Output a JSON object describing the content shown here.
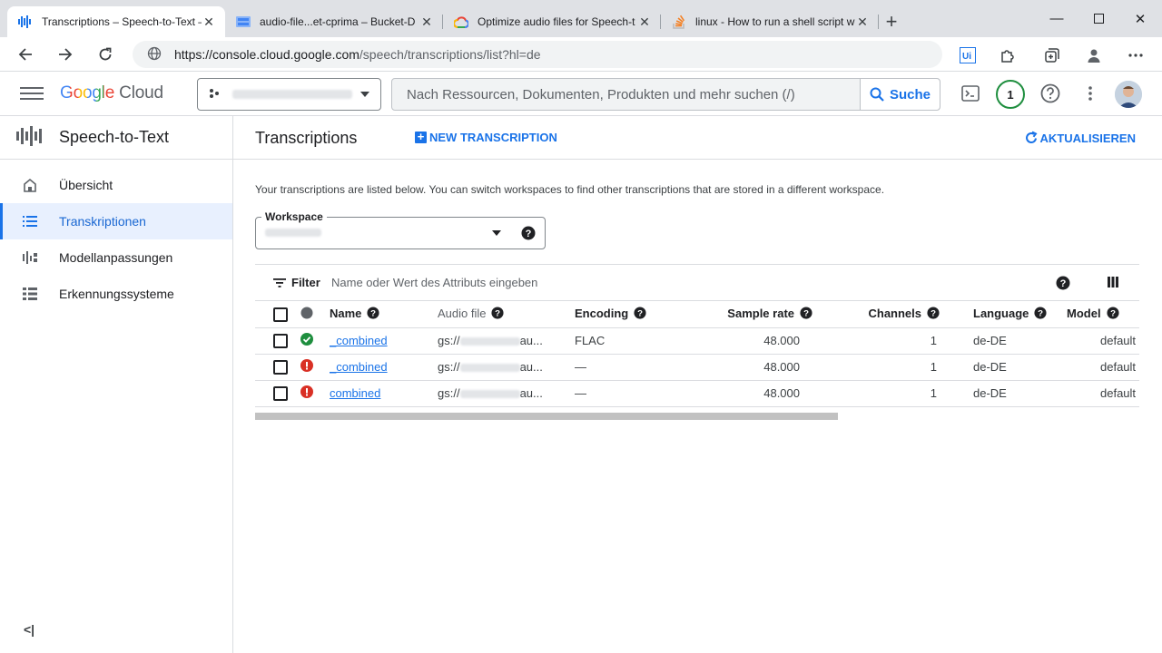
{
  "browser": {
    "tabs": [
      {
        "title": "Transcriptions – Speech-to-Text – ",
        "icon": "speech-to-text-icon",
        "active": true
      },
      {
        "title": "audio-file...et-cprima – Bucket-D",
        "icon": "bucket-icon",
        "active": false
      },
      {
        "title": "Optimize audio files for Speech-t",
        "icon": "google-cloud-icon",
        "active": false
      },
      {
        "title": "linux - How to run a shell script w",
        "icon": "stackoverflow-icon",
        "active": false
      }
    ],
    "new_tab": "+",
    "url_host": "https://console.cloud.google.com",
    "url_rest": "/speech/transcriptions/list?hl=de"
  },
  "header": {
    "logo_google": "Google",
    "logo_cloud": "Cloud",
    "search_placeholder": "Nach Ressourcen, Dokumenten, Produkten und mehr suchen (/)",
    "search_button": "Suche",
    "notification_count": "1"
  },
  "sidebar": {
    "product_title": "Speech-to-Text",
    "items": [
      {
        "label": "Übersicht",
        "icon": "home-icon"
      },
      {
        "label": "Transkriptionen",
        "icon": "list-icon",
        "active": true
      },
      {
        "label": "Modellanpassungen",
        "icon": "model-adaptation-icon"
      },
      {
        "label": "Erkennungssysteme",
        "icon": "recognizers-icon"
      }
    ],
    "collapse": "<|"
  },
  "main": {
    "title": "Transcriptions",
    "new_button": "NEW TRANSCRIPTION",
    "refresh_button": "AKTUALISIEREN",
    "description": "Your transcriptions are listed below. You can switch workspaces to find other transcriptions that are stored in a different workspace.",
    "workspace_label": "Workspace",
    "filter_label": "Filter",
    "filter_placeholder": "Name oder Wert des Attributs eingeben"
  },
  "table": {
    "columns": [
      "Name",
      "Audio file",
      "Encoding",
      "Sample rate",
      "Channels",
      "Language",
      "Model"
    ],
    "rows": [
      {
        "status": "success",
        "name": "_combined",
        "audio_file": "gs://",
        "audio_suffix": "au...",
        "encoding": "FLAC",
        "sample_rate": "48.000",
        "channels": "1",
        "language": "de-DE",
        "model": "default"
      },
      {
        "status": "error",
        "name": "_combined",
        "audio_file": "gs://",
        "audio_suffix": "au...",
        "encoding": "—",
        "sample_rate": "48.000",
        "channels": "1",
        "language": "de-DE",
        "model": "default"
      },
      {
        "status": "error",
        "name": "combined",
        "audio_file": "gs://",
        "audio_suffix": "au...",
        "encoding": "—",
        "sample_rate": "48.000",
        "channels": "1",
        "language": "de-DE",
        "model": "default"
      }
    ]
  },
  "colors": {
    "accent": "#1a73e8",
    "success": "#1e8e3e",
    "error": "#d93025",
    "active_bg": "#e8f0fe"
  }
}
